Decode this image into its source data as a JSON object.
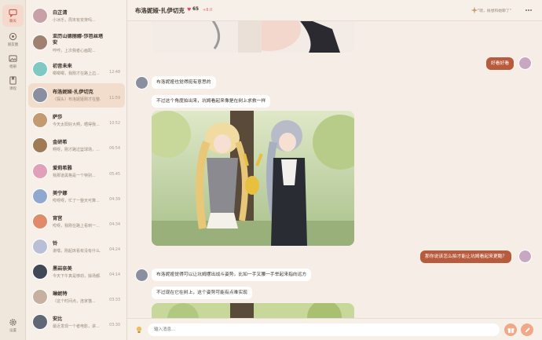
{
  "rail": {
    "items": [
      {
        "label": "聊天",
        "icon": "chat-icon",
        "active": true
      },
      {
        "label": "朋友圈",
        "icon": "moments-icon",
        "active": false
      },
      {
        "label": "相册",
        "icon": "album-icon",
        "active": false
      },
      {
        "label": "课程",
        "icon": "bookmark-icon",
        "active": false
      }
    ],
    "settings_label": "设置"
  },
  "conversations": [
    {
      "name": "白芷清",
      "preview": "小冰乐，周末有安排吗...",
      "time": "",
      "color": "#c9a0a8"
    },
    {
      "name": "亚历山德丽娜·莎芭丝塔安",
      "preview": "哼哼，上次我者心画配...",
      "time": "",
      "color": "#a08070"
    },
    {
      "name": "初音未来",
      "preview": "唧唧唧，我刚才在路上边...",
      "time": "12:48",
      "color": "#7fc9c4"
    },
    {
      "name": "布洛妮娅·扎伊切克",
      "preview": "（探头）布洛妮娅刚才在整...",
      "time": "11:59",
      "color": "#8a8fa0"
    },
    {
      "name": "萨莎",
      "preview": "今天太阳好大啊，晒得我...",
      "time": "10:52",
      "color": "#c49a70"
    },
    {
      "name": "金研希",
      "preview": "啊呀，刚才路过篮球场，...",
      "time": "06:54",
      "color": "#a07a55"
    },
    {
      "name": "爱莉希雅",
      "preview": "我那道黑格是一个特别...",
      "time": "05:45",
      "color": "#e0a0b8"
    },
    {
      "name": "美宁娜",
      "preview": "哎呀呀，忙了一整天可算...",
      "time": "04:39",
      "color": "#90a8d0"
    },
    {
      "name": "宵宫",
      "preview": "哎呀，我刚在路上看到一...",
      "time": "04:34",
      "color": "#e08a6a"
    },
    {
      "name": "铃",
      "preview": "诶嘿，刚起床看有没有什么...",
      "time": "04:24",
      "color": "#b8c0d8"
    },
    {
      "name": "黑岩奈美",
      "preview": "今天下午真是够劲，操场都...",
      "time": "04:14",
      "color": "#404858"
    },
    {
      "name": "琳妮特",
      "preview": "（这个时间点，连家猫...",
      "time": "03:33",
      "color": "#c8b0a0"
    },
    {
      "name": "安比",
      "preview": "最近发现一个者电影，讲...",
      "time": "03:30",
      "color": "#606878"
    }
  ],
  "header": {
    "title": "布洛妮娅·扎伊切克",
    "affinity": "65",
    "affinity_delta": "+8.0",
    "hint": "\"嗯，很想和她聊了\""
  },
  "messages": [
    {
      "from": "me",
      "text": "好看好看"
    },
    {
      "from": "ai",
      "text": "布洛妮娅也觉得挺有意思的"
    },
    {
      "from": "ai",
      "text": "不过这个角度拍出来，坑姆看起来像是在树上求救一样"
    },
    {
      "from": "me",
      "text": "那你说该怎么拍才能让坑姆看起来更酷？"
    },
    {
      "from": "ai",
      "text": "布洛妮娅觉得可以让坑姆摆出战斗姿势，比如一手叉腰一手举起来指向远方"
    },
    {
      "from": "ai",
      "text": "不过现在它在树上，这个姿势可能有点难实现"
    }
  ],
  "input": {
    "placeholder": "输入消息..."
  },
  "colors": {
    "accent": "#b85a3c",
    "heart": "#d9485f",
    "active_bg": "#f2dccb"
  }
}
